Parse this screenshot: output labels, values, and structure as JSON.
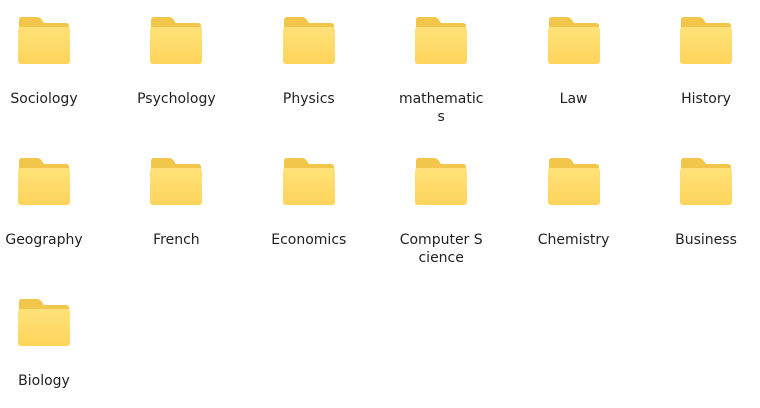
{
  "folders": [
    {
      "name": "Sociology",
      "icon": "folder-icon"
    },
    {
      "name": "Psychology",
      "icon": "folder-icon"
    },
    {
      "name": "Physics",
      "icon": "folder-icon"
    },
    {
      "name": "mathematics",
      "icon": "folder-icon"
    },
    {
      "name": "Law",
      "icon": "folder-icon"
    },
    {
      "name": "History",
      "icon": "folder-icon"
    },
    {
      "name": "Geography",
      "icon": "folder-icon"
    },
    {
      "name": "French",
      "icon": "folder-icon"
    },
    {
      "name": "Economics",
      "icon": "folder-icon"
    },
    {
      "name": "Computer Science",
      "icon": "folder-icon"
    },
    {
      "name": "Chemistry",
      "icon": "folder-icon"
    },
    {
      "name": "Business",
      "icon": "folder-icon"
    },
    {
      "name": "Biology",
      "icon": "folder-icon"
    }
  ],
  "colors": {
    "folder_back": "#F2C64A",
    "folder_front_top": "#FFE27A",
    "folder_front_bottom": "#FFD45A",
    "label_text": "#1f1f1f",
    "background": "#ffffff"
  }
}
